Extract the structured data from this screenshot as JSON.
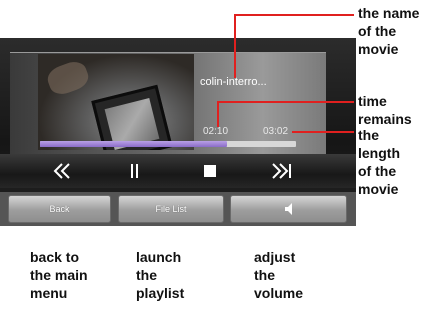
{
  "player": {
    "movie_title": "colin-interro...",
    "time_remaining": "02:10",
    "time_length": "03:02",
    "progress": 0.73,
    "controls": {
      "previous_icon": "skip-back-icon",
      "pause_icon": "pause-icon",
      "stop_icon": "stop-icon",
      "next_icon": "skip-forward-icon"
    },
    "softkeys": {
      "back_label": "Back",
      "file_list_label": "File List",
      "volume_icon": "speaker-icon"
    },
    "accent_color": "#8a6cc8"
  },
  "annotations": {
    "movie_name": "the name\nof the\nmovie",
    "time_remains": "time\nremains",
    "length": "the\nlength\nof the\nmovie",
    "back": "back to\nthe main\nmenu",
    "playlist": "launch\nthe\nplaylist",
    "volume": "adjust\nthe\nvolume"
  }
}
